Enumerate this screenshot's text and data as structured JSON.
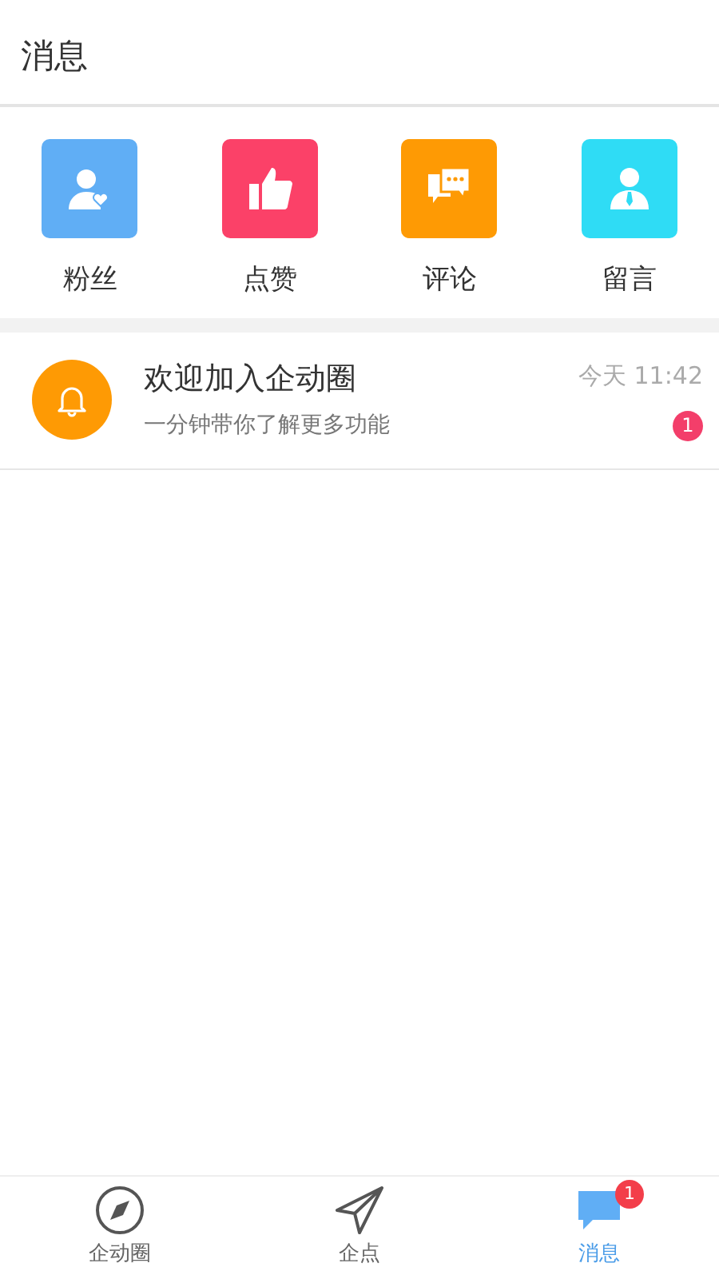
{
  "header": {
    "title": "消息"
  },
  "categories": [
    {
      "kind": "fans",
      "label": "粉丝",
      "color": "#60aef5"
    },
    {
      "kind": "likes",
      "label": "点赞",
      "color": "#fb4168"
    },
    {
      "kind": "comments",
      "label": "评论",
      "color": "#fe9a04"
    },
    {
      "kind": "messages",
      "label": "留言",
      "color": "#2fdcf5"
    }
  ],
  "messages": [
    {
      "title": "欢迎加入企动圈",
      "preview": "一分钟带你了解更多功能",
      "time": "今天 11:42",
      "unread": "1"
    }
  ],
  "tab_bar": [
    {
      "kind": "compass",
      "label": "企动圈",
      "selected": false
    },
    {
      "kind": "send",
      "label": "企点",
      "selected": false
    },
    {
      "kind": "chat",
      "label": "消息",
      "selected": true,
      "badge": "1"
    }
  ]
}
